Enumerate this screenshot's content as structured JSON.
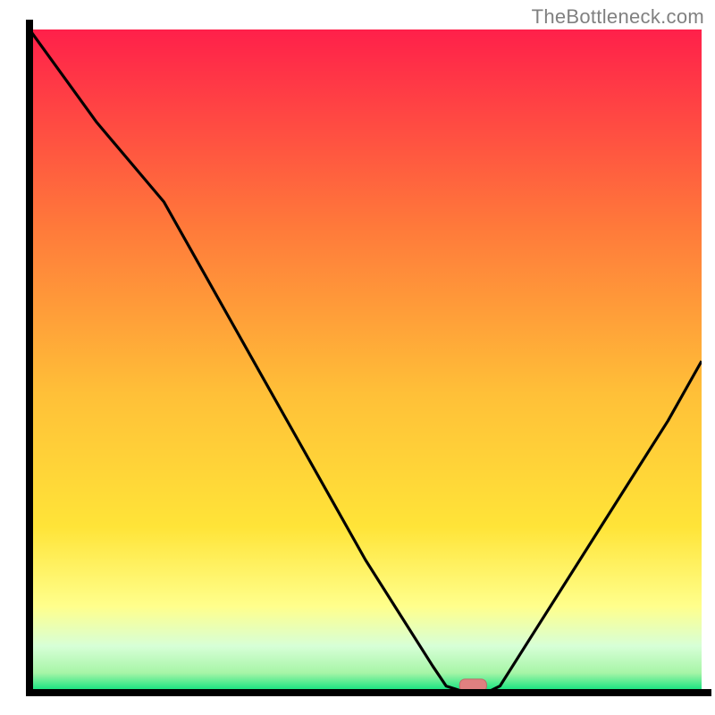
{
  "watermark": "TheBottleneck.com",
  "colors": {
    "axis": "#000000",
    "curve": "#000000",
    "marker_fill": "#e08080",
    "grad_top": "#ff204a",
    "grad_orange": "#ff7a3a",
    "grad_yellow": "#ffe438",
    "grad_pale": "#ffff8c",
    "grad_green_light": "#a7f5a7",
    "grad_green": "#00e07a"
  },
  "chart_data": {
    "type": "line",
    "title": "",
    "xlabel": "",
    "ylabel": "",
    "xlim": [
      0,
      100
    ],
    "ylim": [
      0,
      100
    ],
    "x": [
      0,
      5,
      10,
      15,
      20,
      25,
      30,
      35,
      40,
      45,
      50,
      55,
      60,
      62,
      65,
      68,
      70,
      75,
      80,
      85,
      90,
      95,
      100
    ],
    "values": [
      100,
      93,
      86,
      80,
      74,
      65,
      56,
      47,
      38,
      29,
      20,
      12,
      4,
      1,
      0,
      0,
      1,
      9,
      17,
      25,
      33,
      41,
      50
    ],
    "series": [
      {
        "name": "bottleneck-curve",
        "x": [
          0,
          5,
          10,
          15,
          20,
          25,
          30,
          35,
          40,
          45,
          50,
          55,
          60,
          62,
          65,
          68,
          70,
          75,
          80,
          85,
          90,
          95,
          100
        ],
        "values": [
          100,
          93,
          86,
          80,
          74,
          65,
          56,
          47,
          38,
          29,
          20,
          12,
          4,
          1,
          0,
          0,
          1,
          9,
          17,
          25,
          33,
          41,
          50
        ]
      }
    ],
    "marker": {
      "x": 66,
      "y": 0,
      "w": 4,
      "h": 1.5
    },
    "legend": []
  }
}
